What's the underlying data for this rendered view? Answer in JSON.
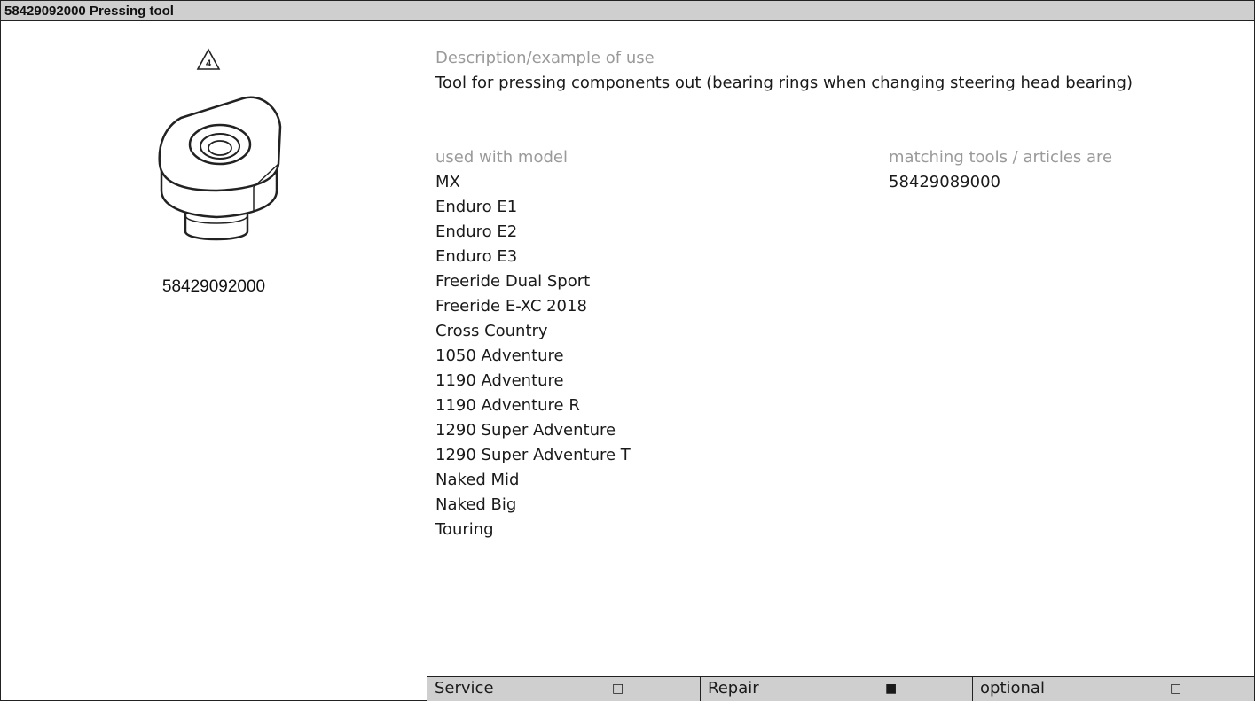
{
  "header": {
    "title": "58429092000 Pressing tool"
  },
  "left": {
    "warning_number": "4",
    "tool_number": "58429092000"
  },
  "description": {
    "label": "Description/example of use",
    "text": "Tool for pressing components out (bearing rings when changing steering head bearing)"
  },
  "models": {
    "label": "used with model",
    "items": [
      "MX",
      "Enduro E1",
      "Enduro E2",
      "Enduro E3",
      "Freeride Dual Sport",
      "Freeride E-XC 2018",
      "Cross Country",
      "1050 Adventure",
      "1190 Adventure",
      "1190 Adventure R",
      "1290 Super Adventure",
      "1290 Super Adventure T",
      "Naked Mid",
      "Naked Big",
      "Touring"
    ]
  },
  "matching": {
    "label": "matching tools / articles are",
    "items": [
      "58429089000"
    ]
  },
  "footer": {
    "service": {
      "label": "Service",
      "box": "□"
    },
    "repair": {
      "label": "Repair",
      "box": "■"
    },
    "optional": {
      "label": "optional",
      "box": "□"
    }
  }
}
